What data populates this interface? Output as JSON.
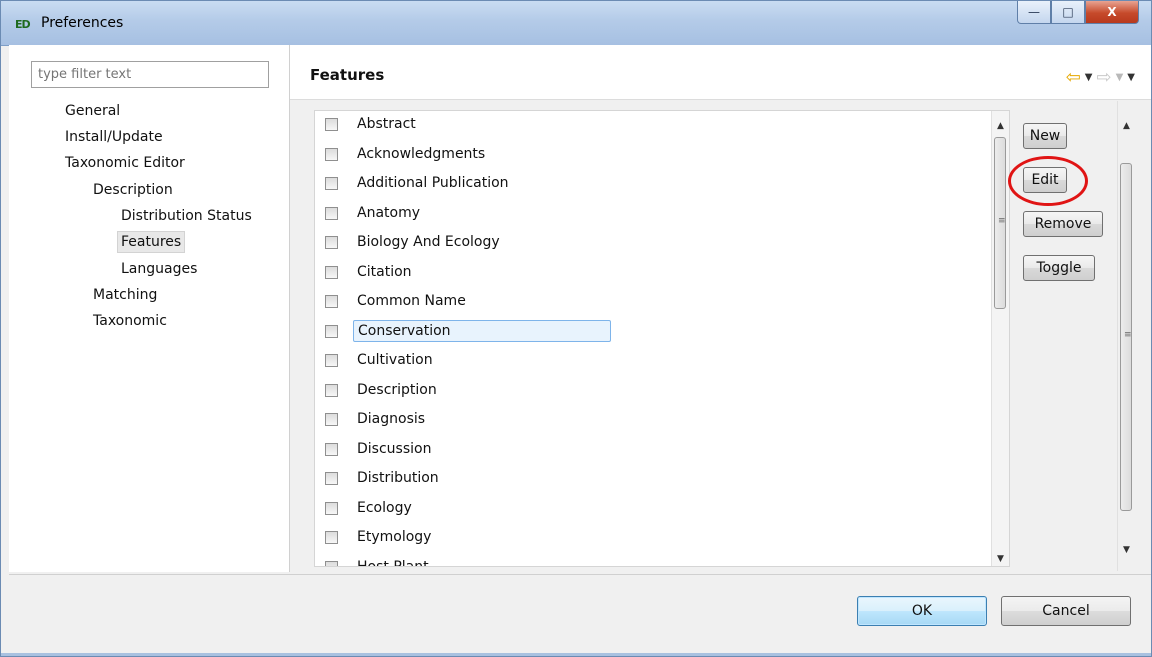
{
  "window": {
    "title": "Preferences",
    "app_icon_text": "ED",
    "controls": {
      "minimize": "—",
      "maximize": "□",
      "close": "X"
    }
  },
  "left": {
    "filter_placeholder": "type filter text",
    "tree": [
      {
        "label": "General"
      },
      {
        "label": "Install/Update"
      },
      {
        "label": "Taxonomic Editor"
      },
      {
        "label": "Description"
      },
      {
        "label": "Distribution Status"
      },
      {
        "label": "Features",
        "selected": true
      },
      {
        "label": "Languages"
      },
      {
        "label": "Matching"
      },
      {
        "label": "Taxonomic"
      }
    ]
  },
  "main": {
    "title": "Features",
    "nav": {
      "back": "⇦",
      "back_dd": "▼",
      "forward": "⇨",
      "forward_dd": "▼",
      "menu": "▼"
    },
    "features": [
      "Abstract",
      "Acknowledgments",
      "Additional Publication",
      "Anatomy",
      "Biology And Ecology",
      "Citation",
      "Common Name",
      "Conservation",
      "Cultivation",
      "Description",
      "Diagnosis",
      "Discussion",
      "Distribution",
      "Ecology",
      "Etymology",
      "Host Plant"
    ],
    "selected_feature": "Conservation",
    "buttons": {
      "new": "New",
      "edit": "Edit",
      "remove": "Remove",
      "toggle": "Toggle"
    }
  },
  "footer": {
    "ok": "OK",
    "cancel": "Cancel"
  },
  "colors": {
    "highlight_ring": "#e01414",
    "selection_border": "#7eb4ea"
  }
}
